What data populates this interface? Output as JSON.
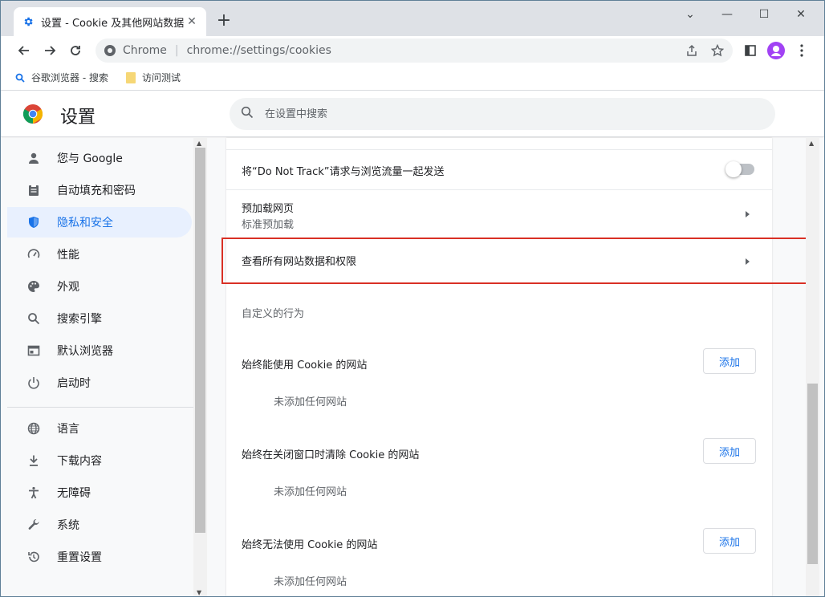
{
  "tab": {
    "title": "设置 - Cookie 及其他网站数据",
    "favicon": "gear-icon"
  },
  "window_controls": [
    "chevron-down-icon",
    "minimize-icon",
    "maximize-icon",
    "close-icon"
  ],
  "omnibox": {
    "site_label": "Chrome",
    "separator": "|",
    "url": "chrome://settings/cookies"
  },
  "bookmarks": [
    {
      "label": "谷歌浏览器 - 搜索",
      "icon": "search-icon"
    },
    {
      "label": "访问测试",
      "icon": "folder-icon"
    }
  ],
  "header": {
    "title": "设置",
    "search_placeholder": "在设置中搜索"
  },
  "sidebar": {
    "items": [
      {
        "label": "您与 Google",
        "icon": "person-icon"
      },
      {
        "label": "自动填充和密码",
        "icon": "clipboard-icon"
      },
      {
        "label": "隐私和安全",
        "icon": "shield-icon",
        "active": true
      },
      {
        "label": "性能",
        "icon": "speedometer-icon"
      },
      {
        "label": "外观",
        "icon": "palette-icon"
      },
      {
        "label": "搜索引擎",
        "icon": "search-icon"
      },
      {
        "label": "默认浏览器",
        "icon": "browser-icon"
      },
      {
        "label": "启动时",
        "icon": "power-icon"
      },
      {
        "label": "语言",
        "icon": "globe-icon"
      },
      {
        "label": "下载内容",
        "icon": "download-icon"
      },
      {
        "label": "无障碍",
        "icon": "accessibility-icon"
      },
      {
        "label": "系统",
        "icon": "wrench-icon"
      },
      {
        "label": "重置设置",
        "icon": "reset-icon"
      }
    ]
  },
  "main": {
    "dnt_label": "将“Do Not Track”请求与浏览流量一起发送",
    "preload_title": "预加载网页",
    "preload_sub": "标准预加载",
    "view_all_label": "查看所有网站数据和权限",
    "custom_behavior_label": "自定义的行为",
    "site_lists": [
      {
        "title": "始终能使用 Cookie 的网站",
        "add": "添加",
        "empty": "未添加任何网站"
      },
      {
        "title": "始终在关闭窗口时清除 Cookie 的网站",
        "add": "添加",
        "empty": "未添加任何网站"
      },
      {
        "title": "始终无法使用 Cookie 的网站",
        "add": "添加",
        "empty": "未添加任何网站"
      }
    ]
  },
  "colors": {
    "accent": "#1a73e8",
    "highlight": "#d93025"
  }
}
